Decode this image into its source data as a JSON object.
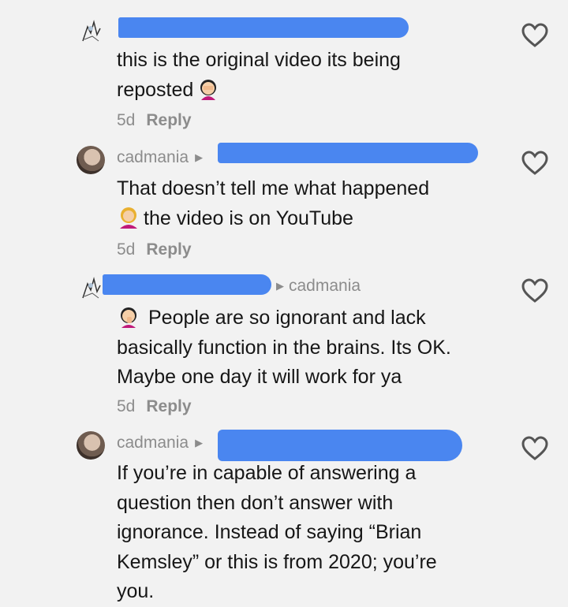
{
  "comments": [
    {
      "username": "",
      "text_lines": [
        "this is the original video its being",
        "reposted"
      ],
      "date": "5d",
      "reply_label": "Reply"
    },
    {
      "username": "cadmania",
      "text_lines": [
        "That doesn’t tell me what happened",
        "the video is on YouTube"
      ],
      "date": "5d",
      "reply_label": "Reply"
    },
    {
      "username": "",
      "reply_to": "cadmania",
      "text_lines": [
        "People are so ignorant and lack",
        "basically function in the brains. Its OK.",
        "Maybe one day it will work for ya"
      ],
      "date": "5d",
      "reply_label": "Reply"
    },
    {
      "username": "cadmania",
      "text_lines": [
        "If you’re in capable of answering a",
        "question then don’t answer with",
        "ignorance. Instead of saying “Brian",
        "Kemsley” or this is from 2020; you’re",
        "you."
      ]
    }
  ],
  "icons": {
    "like": "heart-outline-icon",
    "reply_arrow": "caret-right-icon",
    "emoji_facepalm": "woman-facepalming-emoji",
    "emoji_tipping": "woman-tipping-hand-emoji",
    "emoji_thinking": "woman-hand-on-face-emoji"
  },
  "colors": {
    "background": "#f2f2f2",
    "text": "#161616",
    "muted": "#8c8c8c",
    "redaction": "#4a86f0"
  }
}
